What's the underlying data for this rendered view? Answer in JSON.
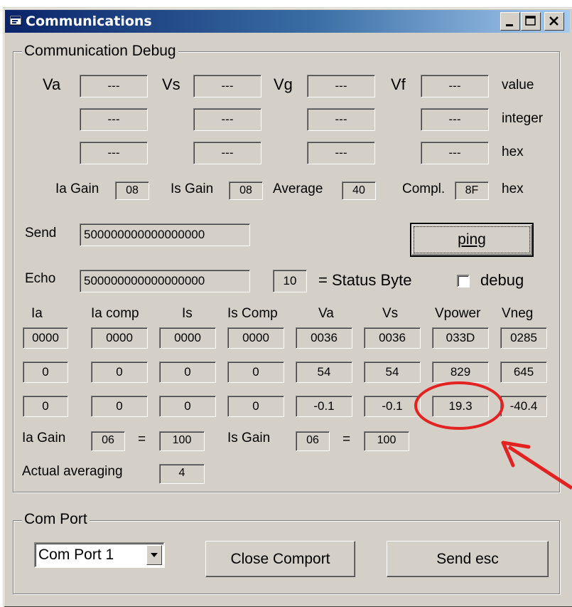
{
  "window": {
    "title": "Communications",
    "title_icon": "window-app-icon",
    "buttons": [
      "minimize",
      "maximize",
      "close"
    ]
  },
  "debug_frame": {
    "label": "Communication Debug",
    "channels": [
      "Va",
      "Vs",
      "Vg",
      "Vf"
    ],
    "row_labels": [
      "value",
      "integer",
      "hex"
    ],
    "channel_values": {
      "value": [
        "---",
        "---",
        "---",
        "---"
      ],
      "integer": [
        "---",
        "---",
        "---",
        "---"
      ],
      "hex": [
        "---",
        "---",
        "---",
        "---"
      ]
    },
    "gains": {
      "ia_gain_label": "Ia Gain",
      "ia_gain": "08",
      "is_gain_label": "Is Gain",
      "is_gain": "08",
      "average_label": "Average",
      "average": "40",
      "compl_label": "Compl.",
      "compl": "8F",
      "unit": "hex"
    },
    "send_label": "Send",
    "send_value": "500000000000000000",
    "ping_label": "ping",
    "echo_label": "Echo",
    "echo_value": "500000000000000000",
    "status_value": "10",
    "status_label": "= Status Byte",
    "debug_label": "debug",
    "debug_checked": false,
    "columns": [
      "Ia",
      "Ia comp",
      "Is",
      "Is Comp",
      "Va",
      "Vs",
      "Vpower",
      "Vneg"
    ],
    "rows": [
      [
        "0000",
        "0000",
        "0000",
        "0000",
        "0036",
        "0036",
        "033D",
        "0285"
      ],
      [
        "0",
        "0",
        "0",
        "0",
        "54",
        "54",
        "829",
        "645"
      ],
      [
        "0",
        "0",
        "0",
        "0",
        "-0.1",
        "-0.1",
        "19.3",
        "-40.4"
      ]
    ],
    "ia_gain2_label": "Ia Gain",
    "ia_gain2": "06",
    "ia_gain2_eq": "=",
    "ia_gain2_result": "100",
    "is_gain2_label": "Is Gain",
    "is_gain2": "06",
    "is_gain2_eq": "=",
    "is_gain2_result": "100",
    "actual_avg_label": "Actual averaging",
    "actual_avg": "4"
  },
  "com_frame": {
    "label": "Com Port",
    "port_selected": "Com Port 1",
    "close_label": "Close Comport",
    "send_esc_label": "Send esc"
  },
  "annotation": {
    "color": "#e32222",
    "shapes": [
      "circle-around-vpower",
      "arrow"
    ]
  }
}
